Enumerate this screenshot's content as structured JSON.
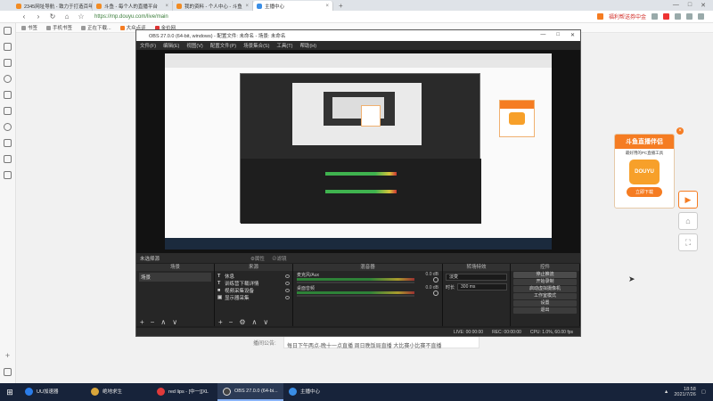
{
  "browser": {
    "tabs": [
      {
        "label": "2345网址导航 - 致力于打造百年品牌",
        "active": false
      },
      {
        "label": "斗鱼 - 每个人的直播平台",
        "active": false
      },
      {
        "label": "我的资料 - 个人中心 - 斗鱼",
        "active": false
      },
      {
        "label": "主播中心",
        "active": true
      }
    ],
    "window_controls": [
      "—",
      "□",
      "✕"
    ],
    "url": "https://mp.douyu.com/live/main",
    "promo_text": "福利帮送券中金",
    "bookmarks": [
      "书签",
      "手机书签",
      "正在下载...",
      "大众点评",
      "金价网"
    ]
  },
  "sidebar_icons": [
    "star-icon",
    "history-icon",
    "book-icon",
    "search-icon",
    "download-icon",
    "game-icon",
    "chat-icon",
    "shield-icon",
    "cart-icon",
    "note-icon"
  ],
  "page": {
    "label": "播间公告:",
    "announcement": "每日下午两点-晚十一点直播 周日晚饭局直播 大比赛小比赛不直播"
  },
  "promo": {
    "title": "斗鱼直播伴侣",
    "subtitle": "最好用的PC直播工具",
    "logo": "DOUYU",
    "download": "立即下载"
  },
  "obs": {
    "title": "OBS 27.0.0 (64-bit, windows) - 配置文件: 未命名 - 场景: 未命名",
    "menu": [
      "文件(F)",
      "编辑(E)",
      "视图(V)",
      "配置文件(P)",
      "场景集合(S)",
      "工具(T)",
      "帮助(H)"
    ],
    "status_text": "未选择源",
    "toolbar_items": [
      "⚙属性",
      "⊘滤镜"
    ],
    "docks": {
      "scenes": {
        "title": "场景",
        "items": [
          "场景"
        ]
      },
      "sources": {
        "title": "来源",
        "items": [
          "休息",
          "训练营下载详情",
          "视频采集设备",
          "显示器采集"
        ]
      },
      "mixer": {
        "title": "混音器",
        "channels": [
          {
            "name": "麦克风/Aux",
            "db": "0.0 dB"
          },
          {
            "name": "桌面音频",
            "db": "0.0 dB"
          }
        ]
      },
      "transitions": {
        "title": "转场特效",
        "fade": "淡变",
        "duration_label": "时长",
        "duration": "300 ms"
      },
      "controls": {
        "title": "控件",
        "buttons": [
          "停止推流",
          "开始录制",
          "启动虚拟摄像机",
          "工作室模式",
          "设置",
          "退出"
        ]
      }
    },
    "statusbar": [
      "LIVE: 00:00:00",
      "REC: 00:00:00",
      "CPU: 1.0%, 60.00 fps"
    ]
  },
  "taskbar": {
    "items": [
      {
        "label": "UU加速器",
        "active": false
      },
      {
        "label": "绝地求生",
        "active": false
      },
      {
        "label": "red lips - [中一][XL",
        "active": false
      },
      {
        "label": "OBS 27.0.0 (64-bi...",
        "active": true
      },
      {
        "label": "主播中心",
        "active": false
      }
    ],
    "time": "18:58",
    "date": "2021/7/26"
  }
}
